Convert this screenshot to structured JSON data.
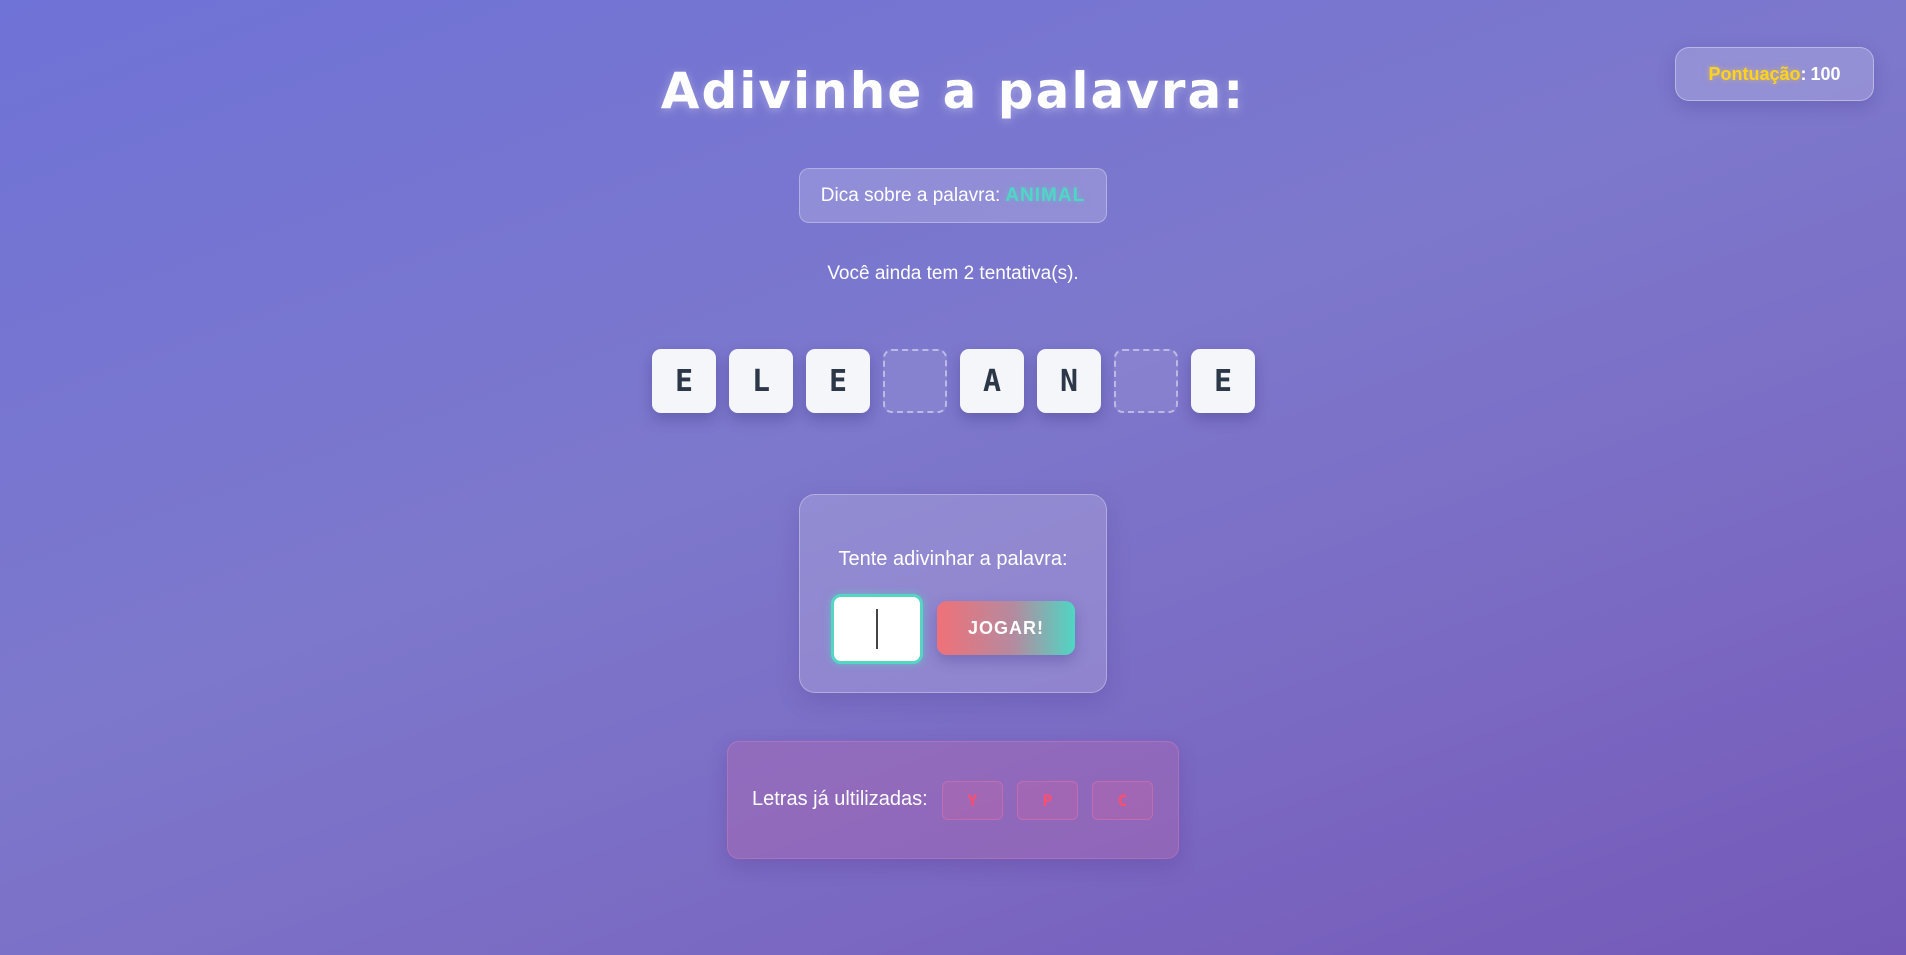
{
  "score": {
    "label": "Pontuação",
    "separator": ":",
    "value": "100"
  },
  "title": "Adivinhe a palavra:",
  "hint": {
    "label": "Dica sobre a palavra:",
    "value": "ANIMAL"
  },
  "attempts_text": "Você ainda tem 2 tentativa(s).",
  "word": {
    "tiles": [
      "E",
      "L",
      "E",
      "",
      "A",
      "N",
      "",
      "E"
    ]
  },
  "guess": {
    "label": "Tente adivinhar a palavra:",
    "input_value": "",
    "button_label": "JOGAR!"
  },
  "used": {
    "label": "Letras já ultilizadas:",
    "letters": [
      "Y",
      "P",
      "C"
    ]
  },
  "colors": {
    "accent_teal": "#4fd6c4",
    "score_gold": "#ffd21f",
    "used_red": "#ff4d6d"
  }
}
